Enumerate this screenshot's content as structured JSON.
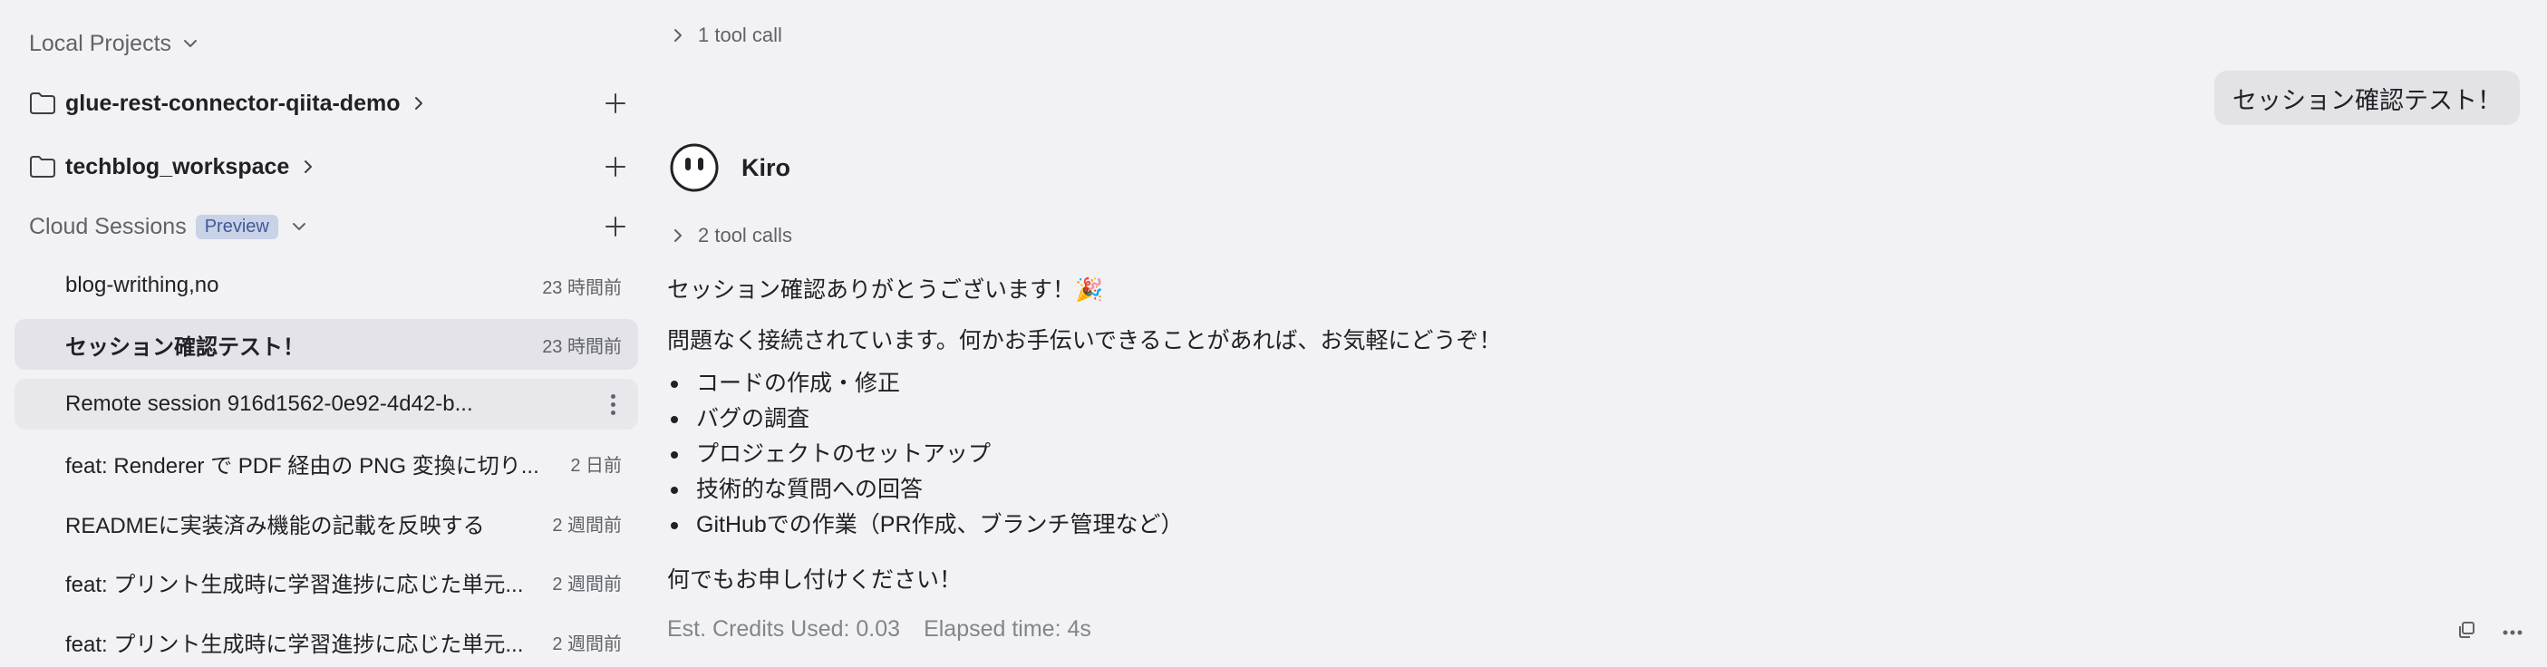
{
  "sidebar": {
    "local_projects_label": "Local Projects",
    "projects": [
      {
        "name": "glue-rest-connector-qiita-demo"
      },
      {
        "name": "techblog_workspace"
      }
    ],
    "cloud_sessions_label": "Cloud Sessions",
    "cloud_badge": "Preview",
    "sessions": [
      {
        "title": "blog-writhing,no",
        "time": "23 時間前"
      },
      {
        "title": "セッション確認テスト！",
        "time": "23 時間前"
      },
      {
        "title": "Remote session 916d1562-0e92-4d42-b...",
        "time": ""
      },
      {
        "title": "feat: Renderer で PDF 経由の PNG 変換に切り...",
        "time": "2 日前"
      },
      {
        "title": "READMEに実装済み機能の記載を反映する",
        "time": "2 週間前"
      },
      {
        "title": "feat: プリント生成時に学習進捗に応じた単元...",
        "time": "2 週間前"
      },
      {
        "title": "feat: プリント生成時に学習進捗に応じた単元...",
        "time": "2 週間前"
      }
    ]
  },
  "chat": {
    "tool_call_top": "1 tool call",
    "user_message": "セッション確認テスト！",
    "assistant_name": "Kiro",
    "tool_calls": "2 tool calls",
    "reply_line1": "セッション確認ありがとうございます！🎉",
    "reply_line2": "問題なく接続されています。何かお手伝いできることがあれば、お気軽にどうぞ！",
    "bullets": [
      "コードの作成・修正",
      "バグの調査",
      "プロジェクトのセットアップ",
      "技術的な質問への回答",
      "GitHubでの作業（PR作成、ブランチ管理など）"
    ],
    "closing": "何でもお申し付けください！",
    "credits": "Est. Credits Used: 0.03",
    "elapsed": "Elapsed time: 4s"
  }
}
